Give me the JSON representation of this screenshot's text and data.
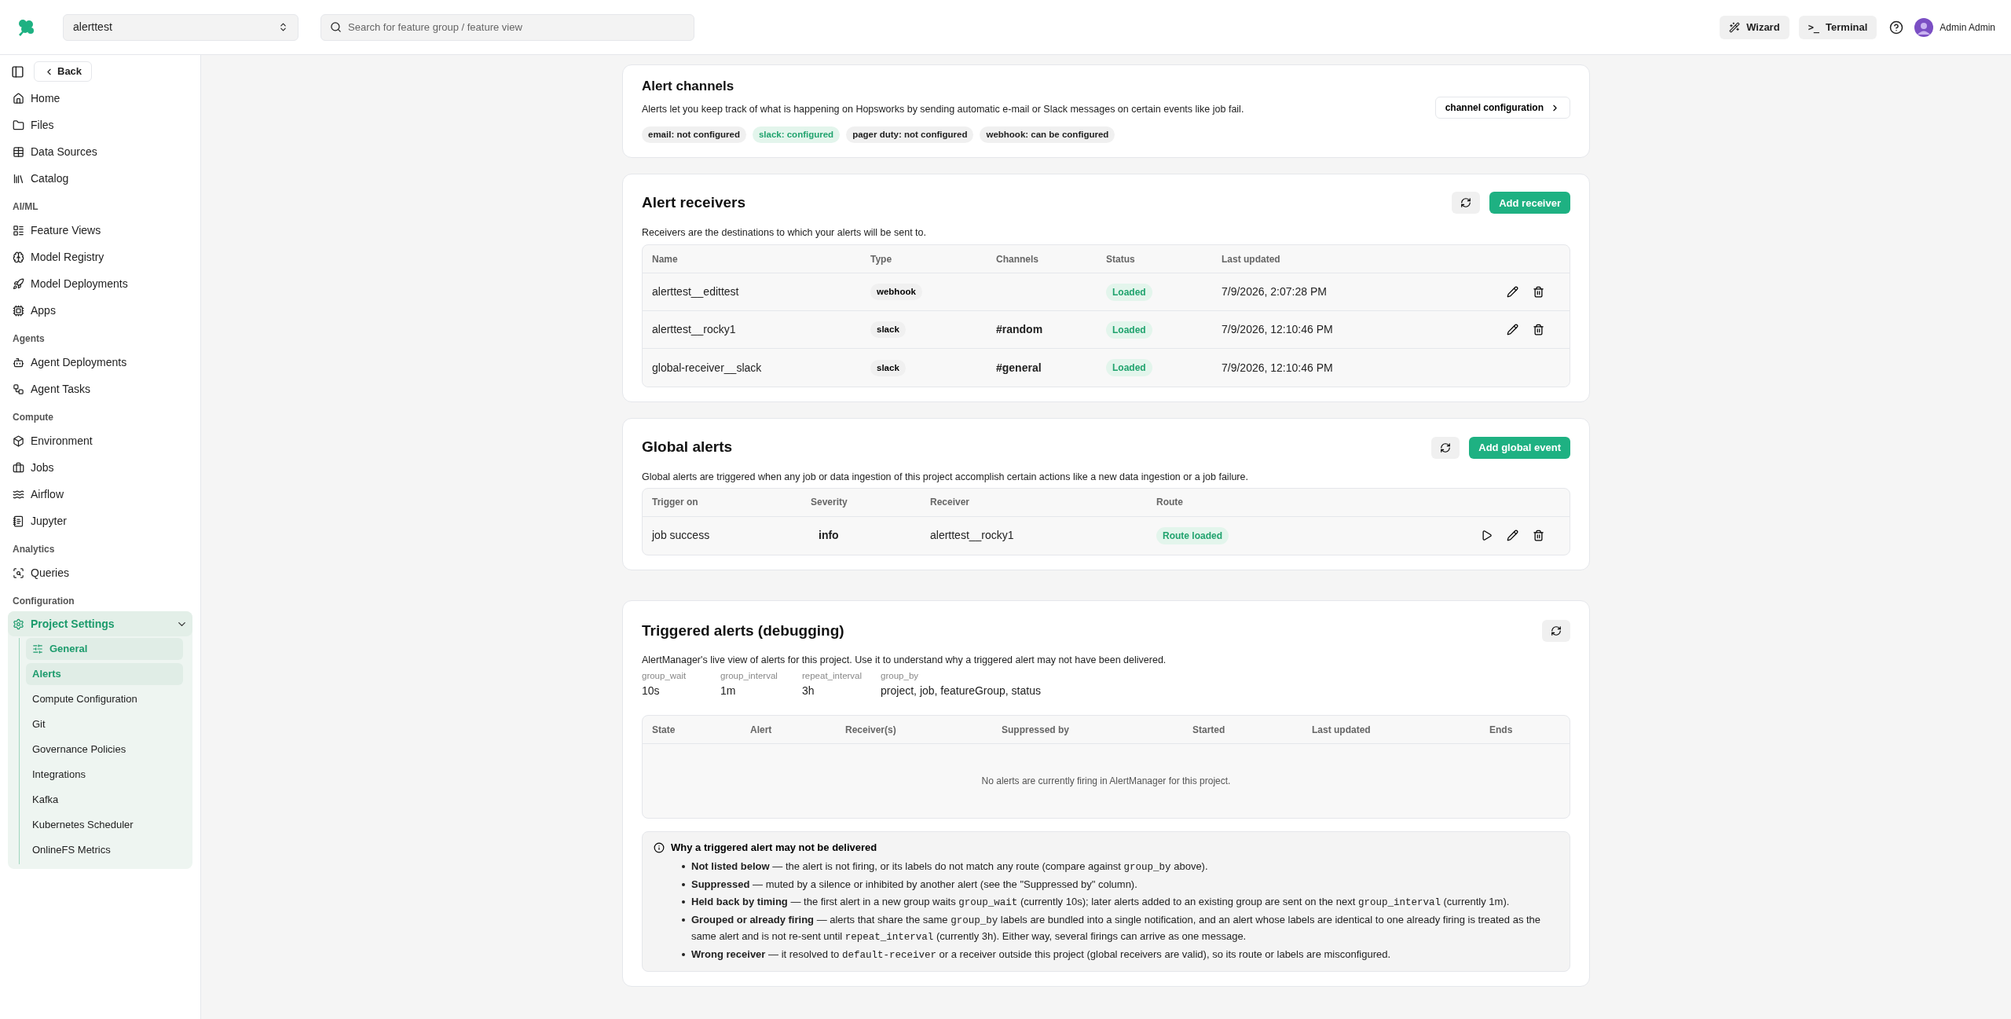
{
  "topbar": {
    "project": "alerttest",
    "search": {
      "placeholder": "Search for feature group / feature view"
    },
    "wizard": "Wizard",
    "terminal_prompt": ">_",
    "terminal": "Terminal",
    "user": "Admin Admin"
  },
  "sidebar": {
    "back": "Back",
    "sections": [
      {
        "items": [
          {
            "label": "Home"
          },
          {
            "label": "Files"
          },
          {
            "label": "Data Sources"
          },
          {
            "label": "Catalog"
          }
        ]
      },
      {
        "heading": "AI/ML",
        "items": [
          {
            "label": "Feature Views"
          },
          {
            "label": "Model Registry"
          },
          {
            "label": "Model Deployments"
          },
          {
            "label": "Apps"
          }
        ]
      },
      {
        "heading": "Agents",
        "items": [
          {
            "label": "Agent Deployments"
          },
          {
            "label": "Agent Tasks"
          }
        ]
      },
      {
        "heading": "Compute",
        "items": [
          {
            "label": "Environment"
          },
          {
            "label": "Jobs"
          },
          {
            "label": "Airflow"
          },
          {
            "label": "Jupyter"
          }
        ]
      },
      {
        "heading": "Analytics",
        "items": [
          {
            "label": "Queries"
          }
        ]
      },
      {
        "heading": "Configuration",
        "items": [
          {
            "label": "Project Settings",
            "expanded": true,
            "children": [
              {
                "label": "General",
                "kind": "icon",
                "selected": true
              },
              {
                "label": "Alerts",
                "kind": "plain",
                "selected": true
              },
              {
                "label": "Compute Configuration",
                "kind": "plain",
                "selected": false
              },
              {
                "label": "Git",
                "kind": "plain",
                "selected": false
              },
              {
                "label": "Governance Policies",
                "kind": "plain",
                "selected": false
              },
              {
                "label": "Integrations",
                "kind": "plain",
                "selected": false
              },
              {
                "label": "Kafka",
                "kind": "plain",
                "selected": false
              },
              {
                "label": "Kubernetes Scheduler",
                "kind": "plain",
                "selected": false
              },
              {
                "label": "OnlineFS Metrics",
                "kind": "plain",
                "selected": false
              }
            ]
          }
        ]
      }
    ]
  },
  "channels": {
    "title": "Alert channels",
    "description": "Alerts let you keep track of what is happening on Hopsworks by sending automatic e-mail or Slack messages on certain events like job fail.",
    "button": "channel configuration",
    "tags": [
      {
        "label": "email: not configured",
        "configured": false
      },
      {
        "label": "slack: configured",
        "configured": true
      },
      {
        "label": "pager duty: not configured",
        "configured": false
      },
      {
        "label": "webhook: can be configured",
        "configured": false
      }
    ]
  },
  "receivers": {
    "title": "Alert receivers",
    "add_button": "Add receiver",
    "description": "Receivers are the destinations to which your alerts will be sent to.",
    "columns": [
      "Name",
      "Type",
      "Channels",
      "Status",
      "Last updated"
    ],
    "rows": [
      {
        "name": "alerttest__edittest",
        "type": "webhook",
        "status": "Loaded",
        "updated": "7/9/2026, 2:07:28 PM",
        "editable": true
      },
      {
        "name": "alerttest__rocky1",
        "type": "slack",
        "channel": "#random",
        "status": "Loaded",
        "updated": "7/9/2026, 12:10:46 PM",
        "editable": true
      },
      {
        "name": "global-receiver__slack",
        "type": "slack",
        "channel": "#general",
        "status": "Loaded",
        "updated": "7/9/2026, 12:10:46 PM",
        "editable": false
      }
    ]
  },
  "global_alerts": {
    "title": "Global alerts",
    "add_button": "Add global event",
    "description": "Global alerts are triggered when any job or data ingestion of this project accomplish certain actions like a new data ingestion or a job failure.",
    "columns": [
      "Trigger on",
      "Severity",
      "Receiver",
      "Route"
    ],
    "rows": [
      {
        "trigger": "job success",
        "severity": "info",
        "receiver": "alerttest__rocky1",
        "route": "Route loaded"
      }
    ]
  },
  "triggered": {
    "title": "Triggered alerts (debugging)",
    "description": "AlertManager's live view of alerts for this project. Use it to understand why a triggered alert may not have been delivered.",
    "params": [
      {
        "label": "group_wait",
        "value": "10s"
      },
      {
        "label": "group_interval",
        "value": "1m"
      },
      {
        "label": "repeat_interval",
        "value": "3h"
      },
      {
        "label": "group_by",
        "value": "project, job, featureGroup, status"
      }
    ],
    "columns": [
      "State",
      "Alert",
      "Receiver(s)",
      "Suppressed by",
      "Started",
      "Last updated",
      "Ends"
    ],
    "empty": "No alerts are currently firing in AlertManager for this project.",
    "help": {
      "title": "Why a triggered alert may not be delivered",
      "bullets": [
        {
          "title": "Not listed below",
          "parts": [
            {
              "kind": "text",
              "text": " — the alert is not firing, or its labels do not match any route (compare against "
            },
            {
              "kind": "code",
              "text": "group_by"
            },
            {
              "kind": "text",
              "text": " above)."
            }
          ]
        },
        {
          "title": "Suppressed",
          "parts": [
            {
              "kind": "text",
              "text": " — muted by a silence or inhibited by another alert (see the \"Suppressed by\" column)."
            }
          ]
        },
        {
          "title": "Held back by timing",
          "parts": [
            {
              "kind": "text",
              "text": " — the first alert in a new group waits "
            },
            {
              "kind": "code",
              "text": "group_wait"
            },
            {
              "kind": "text",
              "text": " (currently 10s); later alerts added to an existing group are sent on the next "
            },
            {
              "kind": "code",
              "text": "group_interval"
            },
            {
              "kind": "text",
              "text": " (currently 1m)."
            }
          ]
        },
        {
          "title": "Grouped or already firing",
          "parts": [
            {
              "kind": "text",
              "text": " — alerts that share the same "
            },
            {
              "kind": "code",
              "text": "group_by"
            },
            {
              "kind": "text",
              "text": " labels are bundled into a single notification, and an alert whose labels are identical to one already firing is treated as the same alert and is not re-sent until "
            },
            {
              "kind": "code",
              "text": "repeat_interval"
            },
            {
              "kind": "text",
              "text": " (currently 3h). Either way, several firings can arrive as one message."
            }
          ]
        },
        {
          "title": "Wrong receiver",
          "parts": [
            {
              "kind": "text",
              "text": " — it resolved to "
            },
            {
              "kind": "code",
              "text": "default-receiver"
            },
            {
              "kind": "text",
              "text": " or a receiver outside this project (global receivers are valid), so its route or labels are misconfigured."
            }
          ]
        }
      ]
    }
  }
}
